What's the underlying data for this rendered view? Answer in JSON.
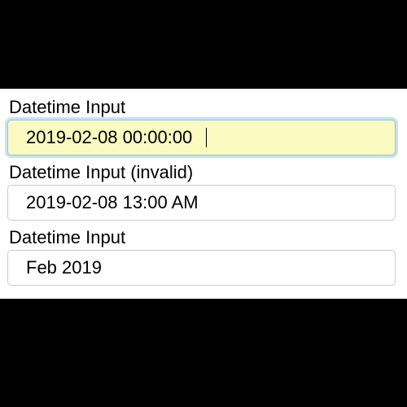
{
  "fields": [
    {
      "label": "Datetime Input",
      "value": "2019-02-08 00:00:00",
      "focused": true
    },
    {
      "label": "Datetime Input (invalid)",
      "value": "2019-02-08 13:00 AM",
      "focused": false
    },
    {
      "label": "Datetime Input",
      "value": "Feb 2019",
      "focused": false
    }
  ],
  "colors": {
    "focus_bg": "#fbfac1",
    "focus_ring": "#8ec5e8"
  }
}
